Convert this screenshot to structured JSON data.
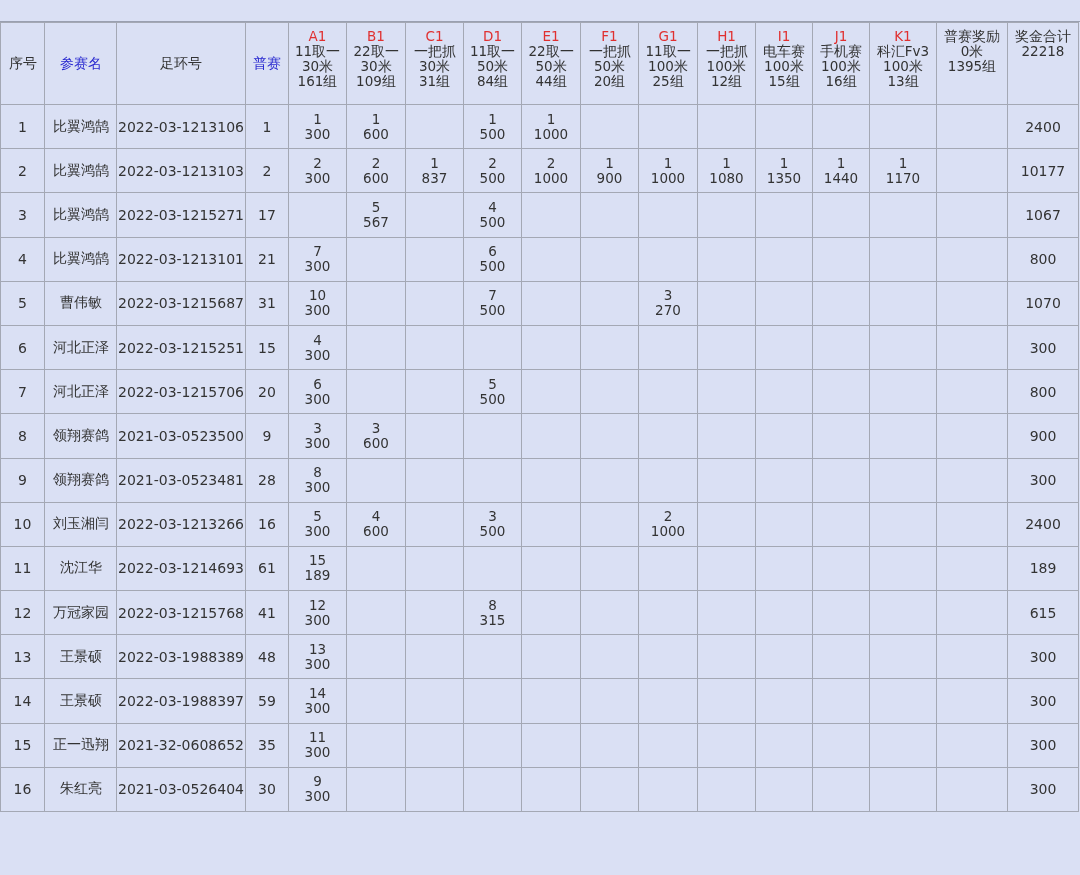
{
  "table": {
    "columns": [
      {
        "kind": "plain",
        "label": "序号"
      },
      {
        "kind": "link",
        "label": "参赛名"
      },
      {
        "kind": "plain",
        "label": "足环号"
      },
      {
        "kind": "link",
        "label": "普赛"
      },
      {
        "kind": "race",
        "code": "A1",
        "lines": [
          "11取一",
          "30米",
          "161组"
        ]
      },
      {
        "kind": "race",
        "code": "B1",
        "lines": [
          "22取一",
          "30米",
          "109组"
        ]
      },
      {
        "kind": "race",
        "code": "C1",
        "lines": [
          "一把抓",
          "30米",
          "31组"
        ]
      },
      {
        "kind": "race",
        "code": "D1",
        "lines": [
          "11取一",
          "50米",
          "84组"
        ]
      },
      {
        "kind": "race",
        "code": "E1",
        "lines": [
          "22取一",
          "50米",
          "44组"
        ]
      },
      {
        "kind": "race",
        "code": "F1",
        "lines": [
          "一把抓",
          "50米",
          "20组"
        ]
      },
      {
        "kind": "race",
        "code": "G1",
        "lines": [
          "11取一",
          "100米",
          "25组"
        ]
      },
      {
        "kind": "race",
        "code": "H1",
        "lines": [
          "一把抓",
          "100米",
          "12组"
        ]
      },
      {
        "kind": "race",
        "code": "I1",
        "lines": [
          "电车赛",
          "100米",
          "15组"
        ]
      },
      {
        "kind": "race",
        "code": "J1",
        "lines": [
          "手机赛",
          "100米",
          "16组"
        ]
      },
      {
        "kind": "race",
        "code": "K1",
        "lines": [
          "科汇Fv3",
          "100米",
          "13组"
        ]
      },
      {
        "kind": "summary",
        "lines": [
          "普赛奖励",
          "0米",
          "1395组"
        ]
      },
      {
        "kind": "summary",
        "lines": [
          "奖金合计",
          "22218"
        ]
      }
    ],
    "rows": [
      {
        "no": "1",
        "name": "比翼鸿鹄",
        "ring": "2022-03-1213106",
        "pusai": "1",
        "results": [
          {
            "kind": "result",
            "rank": "1",
            "prize": "300"
          },
          {
            "kind": "result",
            "rank": "1",
            "prize": "600"
          },
          {
            "kind": "empty"
          },
          {
            "kind": "result",
            "rank": "1",
            "prize": "500"
          },
          {
            "kind": "result",
            "rank": "1",
            "prize": "1000"
          },
          {
            "kind": "empty"
          },
          {
            "kind": "empty"
          },
          {
            "kind": "empty"
          },
          {
            "kind": "empty"
          },
          {
            "kind": "empty"
          },
          {
            "kind": "empty"
          },
          {
            "kind": "empty"
          }
        ],
        "total": "2400"
      },
      {
        "no": "2",
        "name": "比翼鸿鹄",
        "ring": "2022-03-1213103",
        "pusai": "2",
        "results": [
          {
            "kind": "result",
            "rank": "2",
            "prize": "300"
          },
          {
            "kind": "result",
            "rank": "2",
            "prize": "600"
          },
          {
            "kind": "result",
            "rank": "1",
            "prize": "837"
          },
          {
            "kind": "result",
            "rank": "2",
            "prize": "500"
          },
          {
            "kind": "result",
            "rank": "2",
            "prize": "1000"
          },
          {
            "kind": "result",
            "rank": "1",
            "prize": "900"
          },
          {
            "kind": "result",
            "rank": "1",
            "prize": "1000"
          },
          {
            "kind": "result",
            "rank": "1",
            "prize": "1080"
          },
          {
            "kind": "result",
            "rank": "1",
            "prize": "1350"
          },
          {
            "kind": "result",
            "rank": "1",
            "prize": "1440"
          },
          {
            "kind": "result",
            "rank": "1",
            "prize": "1170"
          },
          {
            "kind": "empty"
          }
        ],
        "total": "10177"
      },
      {
        "no": "3",
        "name": "比翼鸿鹄",
        "ring": "2022-03-1215271",
        "pusai": "17",
        "results": [
          {
            "kind": "empty"
          },
          {
            "kind": "result",
            "rank": "5",
            "prize": "567"
          },
          {
            "kind": "empty"
          },
          {
            "kind": "result",
            "rank": "4",
            "prize": "500"
          },
          {
            "kind": "empty"
          },
          {
            "kind": "empty"
          },
          {
            "kind": "empty"
          },
          {
            "kind": "empty"
          },
          {
            "kind": "empty"
          },
          {
            "kind": "empty"
          },
          {
            "kind": "empty"
          },
          {
            "kind": "empty"
          }
        ],
        "total": "1067"
      },
      {
        "no": "4",
        "name": "比翼鸿鹄",
        "ring": "2022-03-1213101",
        "pusai": "21",
        "results": [
          {
            "kind": "result",
            "rank": "7",
            "prize": "300"
          },
          {
            "kind": "empty"
          },
          {
            "kind": "empty"
          },
          {
            "kind": "result",
            "rank": "6",
            "prize": "500"
          },
          {
            "kind": "empty"
          },
          {
            "kind": "empty"
          },
          {
            "kind": "empty"
          },
          {
            "kind": "empty"
          },
          {
            "kind": "empty"
          },
          {
            "kind": "empty"
          },
          {
            "kind": "empty"
          },
          {
            "kind": "empty"
          }
        ],
        "total": "800"
      },
      {
        "no": "5",
        "name": "曹伟敏",
        "ring": "2022-03-1215687",
        "pusai": "31",
        "results": [
          {
            "kind": "result",
            "rank": "10",
            "prize": "300"
          },
          {
            "kind": "empty"
          },
          {
            "kind": "empty"
          },
          {
            "kind": "result",
            "rank": "7",
            "prize": "500"
          },
          {
            "kind": "empty"
          },
          {
            "kind": "empty"
          },
          {
            "kind": "result",
            "rank": "3",
            "prize": "270"
          },
          {
            "kind": "empty"
          },
          {
            "kind": "empty"
          },
          {
            "kind": "empty"
          },
          {
            "kind": "empty"
          },
          {
            "kind": "empty"
          }
        ],
        "total": "1070"
      },
      {
        "no": "6",
        "name": "河北正泽",
        "ring": "2022-03-1215251",
        "pusai": "15",
        "results": [
          {
            "kind": "result",
            "rank": "4",
            "prize": "300"
          },
          {
            "kind": "empty"
          },
          {
            "kind": "empty"
          },
          {
            "kind": "empty"
          },
          {
            "kind": "empty"
          },
          {
            "kind": "empty"
          },
          {
            "kind": "empty"
          },
          {
            "kind": "empty"
          },
          {
            "kind": "empty"
          },
          {
            "kind": "empty"
          },
          {
            "kind": "empty"
          },
          {
            "kind": "empty"
          }
        ],
        "total": "300"
      },
      {
        "no": "7",
        "name": "河北正泽",
        "ring": "2022-03-1215706",
        "pusai": "20",
        "results": [
          {
            "kind": "result",
            "rank": "6",
            "prize": "300"
          },
          {
            "kind": "empty"
          },
          {
            "kind": "empty"
          },
          {
            "kind": "result",
            "rank": "5",
            "prize": "500"
          },
          {
            "kind": "empty"
          },
          {
            "kind": "empty"
          },
          {
            "kind": "empty"
          },
          {
            "kind": "empty"
          },
          {
            "kind": "empty"
          },
          {
            "kind": "empty"
          },
          {
            "kind": "empty"
          },
          {
            "kind": "empty"
          }
        ],
        "total": "800"
      },
      {
        "no": "8",
        "name": "领翔赛鸽",
        "ring": "2021-03-0523500",
        "pusai": "9",
        "results": [
          {
            "kind": "result",
            "rank": "3",
            "prize": "300"
          },
          {
            "kind": "result",
            "rank": "3",
            "prize": "600"
          },
          {
            "kind": "empty"
          },
          {
            "kind": "empty"
          },
          {
            "kind": "empty"
          },
          {
            "kind": "empty"
          },
          {
            "kind": "empty"
          },
          {
            "kind": "empty"
          },
          {
            "kind": "empty"
          },
          {
            "kind": "empty"
          },
          {
            "kind": "empty"
          },
          {
            "kind": "empty"
          }
        ],
        "total": "900"
      },
      {
        "no": "9",
        "name": "领翔赛鸽",
        "ring": "2021-03-0523481",
        "pusai": "28",
        "results": [
          {
            "kind": "result",
            "rank": "8",
            "prize": "300"
          },
          {
            "kind": "empty"
          },
          {
            "kind": "empty"
          },
          {
            "kind": "empty"
          },
          {
            "kind": "empty"
          },
          {
            "kind": "empty"
          },
          {
            "kind": "empty"
          },
          {
            "kind": "empty"
          },
          {
            "kind": "empty"
          },
          {
            "kind": "empty"
          },
          {
            "kind": "empty"
          },
          {
            "kind": "empty"
          }
        ],
        "total": "300"
      },
      {
        "no": "10",
        "name": "刘玉湘闫",
        "ring": "2022-03-1213266",
        "pusai": "16",
        "results": [
          {
            "kind": "result",
            "rank": "5",
            "prize": "300"
          },
          {
            "kind": "result",
            "rank": "4",
            "prize": "600"
          },
          {
            "kind": "empty"
          },
          {
            "kind": "result",
            "rank": "3",
            "prize": "500"
          },
          {
            "kind": "empty"
          },
          {
            "kind": "empty"
          },
          {
            "kind": "result",
            "rank": "2",
            "prize": "1000"
          },
          {
            "kind": "empty"
          },
          {
            "kind": "empty"
          },
          {
            "kind": "empty"
          },
          {
            "kind": "empty"
          },
          {
            "kind": "empty"
          }
        ],
        "total": "2400"
      },
      {
        "no": "11",
        "name": "沈江华",
        "ring": "2022-03-1214693",
        "pusai": "61",
        "results": [
          {
            "kind": "result",
            "rank": "15",
            "prize": "189"
          },
          {
            "kind": "empty"
          },
          {
            "kind": "empty"
          },
          {
            "kind": "empty"
          },
          {
            "kind": "empty"
          },
          {
            "kind": "empty"
          },
          {
            "kind": "empty"
          },
          {
            "kind": "empty"
          },
          {
            "kind": "empty"
          },
          {
            "kind": "empty"
          },
          {
            "kind": "empty"
          },
          {
            "kind": "empty"
          }
        ],
        "total": "189"
      },
      {
        "no": "12",
        "name": "万冠家园",
        "ring": "2022-03-1215768",
        "pusai": "41",
        "results": [
          {
            "kind": "result",
            "rank": "12",
            "prize": "300"
          },
          {
            "kind": "empty"
          },
          {
            "kind": "empty"
          },
          {
            "kind": "result",
            "rank": "8",
            "prize": "315"
          },
          {
            "kind": "empty"
          },
          {
            "kind": "empty"
          },
          {
            "kind": "empty"
          },
          {
            "kind": "empty"
          },
          {
            "kind": "empty"
          },
          {
            "kind": "empty"
          },
          {
            "kind": "empty"
          },
          {
            "kind": "empty"
          }
        ],
        "total": "615"
      },
      {
        "no": "13",
        "name": "王景硕",
        "ring": "2022-03-1988389",
        "pusai": "48",
        "results": [
          {
            "kind": "result",
            "rank": "13",
            "prize": "300"
          },
          {
            "kind": "empty"
          },
          {
            "kind": "empty"
          },
          {
            "kind": "empty"
          },
          {
            "kind": "empty"
          },
          {
            "kind": "empty"
          },
          {
            "kind": "empty"
          },
          {
            "kind": "empty"
          },
          {
            "kind": "empty"
          },
          {
            "kind": "empty"
          },
          {
            "kind": "empty"
          },
          {
            "kind": "empty"
          }
        ],
        "total": "300"
      },
      {
        "no": "14",
        "name": "王景硕",
        "ring": "2022-03-1988397",
        "pusai": "59",
        "results": [
          {
            "kind": "result",
            "rank": "14",
            "prize": "300"
          },
          {
            "kind": "empty"
          },
          {
            "kind": "empty"
          },
          {
            "kind": "empty"
          },
          {
            "kind": "empty"
          },
          {
            "kind": "empty"
          },
          {
            "kind": "empty"
          },
          {
            "kind": "empty"
          },
          {
            "kind": "empty"
          },
          {
            "kind": "empty"
          },
          {
            "kind": "empty"
          },
          {
            "kind": "empty"
          }
        ],
        "total": "300"
      },
      {
        "no": "15",
        "name": "正一迅翔",
        "ring": "2021-32-0608652",
        "pusai": "35",
        "results": [
          {
            "kind": "result",
            "rank": "11",
            "prize": "300"
          },
          {
            "kind": "empty"
          },
          {
            "kind": "empty"
          },
          {
            "kind": "empty"
          },
          {
            "kind": "empty"
          },
          {
            "kind": "empty"
          },
          {
            "kind": "empty"
          },
          {
            "kind": "empty"
          },
          {
            "kind": "empty"
          },
          {
            "kind": "empty"
          },
          {
            "kind": "empty"
          },
          {
            "kind": "empty"
          }
        ],
        "total": "300"
      },
      {
        "no": "16",
        "name": "朱红亮",
        "ring": "2021-03-0526404",
        "pusai": "30",
        "results": [
          {
            "kind": "result",
            "rank": "9",
            "prize": "300"
          },
          {
            "kind": "empty"
          },
          {
            "kind": "empty"
          },
          {
            "kind": "empty"
          },
          {
            "kind": "empty"
          },
          {
            "kind": "empty"
          },
          {
            "kind": "empty"
          },
          {
            "kind": "empty"
          },
          {
            "kind": "empty"
          },
          {
            "kind": "empty"
          },
          {
            "kind": "empty"
          },
          {
            "kind": "empty"
          }
        ],
        "total": "300"
      }
    ]
  }
}
